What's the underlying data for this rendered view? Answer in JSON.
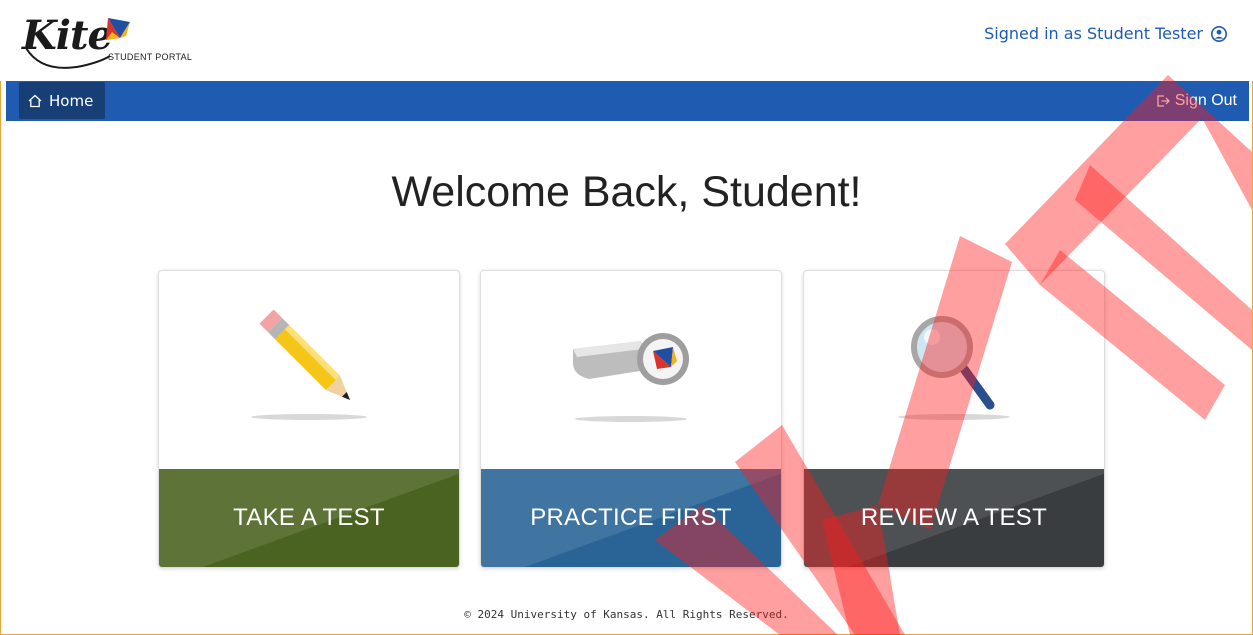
{
  "header": {
    "logo_text": "Kite",
    "logo_subtitle": "STUDENT PORTAL",
    "signed_in_text": "Signed in as Student Tester",
    "user_icon": "user-circle-icon"
  },
  "nav": {
    "home_label": "Home",
    "home_icon": "home-icon",
    "signout_label": "Sign Out",
    "signout_icon": "sign-out-icon"
  },
  "main": {
    "welcome": "Welcome Back, Student!",
    "cards": [
      {
        "label": "TAKE A TEST",
        "icon": "pencil-icon",
        "color": "#4b6320"
      },
      {
        "label": "PRACTICE FIRST",
        "icon": "whistle-icon",
        "color": "#2a6496"
      },
      {
        "label": "REVIEW A TEST",
        "icon": "magnifier-icon",
        "color": "#3a3d40"
      }
    ]
  },
  "footer": {
    "copyright": "© 2024 University of Kansas. All Rights Reserved."
  },
  "watermark": {
    "text": "LIVE",
    "color": "#ff1a1a"
  },
  "colors": {
    "navbar": "#1f5bb1",
    "nav_home_active": "#173f76",
    "link_blue": "#1e5bb5",
    "frame_border": "#e5a63b"
  }
}
